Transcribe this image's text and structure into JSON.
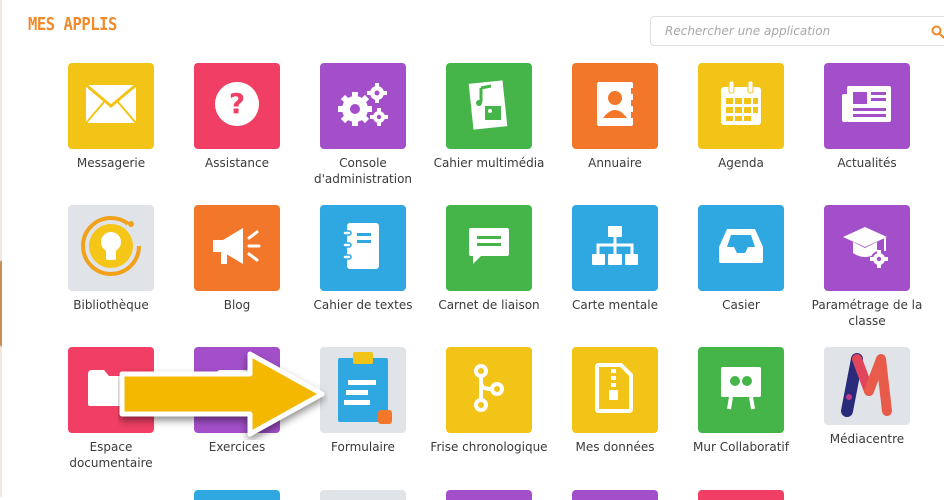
{
  "header": {
    "title": "MES APPLIS",
    "search_placeholder": "Rechercher une application"
  },
  "colors": {
    "accent": "#f08a2b"
  },
  "apps": [
    {
      "label": "Messagerie",
      "icon": "envelope-icon",
      "color": "#f2c418"
    },
    {
      "label": "Assistance",
      "icon": "question-icon",
      "color": "#f03e64"
    },
    {
      "label": "Console d'administration",
      "icon": "gears-icon",
      "color": "#a24fc9"
    },
    {
      "label": "Cahier multimédia",
      "icon": "multimedia-book-icon",
      "color": "#45b54a"
    },
    {
      "label": "Annuaire",
      "icon": "address-book-icon",
      "color": "#f2772a"
    },
    {
      "label": "Agenda",
      "icon": "calendar-icon",
      "color": "#f2c418"
    },
    {
      "label": "Actualités",
      "icon": "newspaper-icon",
      "color": "#a24fc9"
    },
    {
      "label": "Bibliothèque",
      "icon": "lightbulb-icon",
      "color": "#e0e3e8"
    },
    {
      "label": "Blog",
      "icon": "megaphone-icon",
      "color": "#f2772a"
    },
    {
      "label": "Cahier de textes",
      "icon": "notebook-icon",
      "color": "#2fa7e0"
    },
    {
      "label": "Carnet de liaison",
      "icon": "chat-bubble-icon",
      "color": "#45b54a"
    },
    {
      "label": "Carte mentale",
      "icon": "sitemap-icon",
      "color": "#2fa7e0"
    },
    {
      "label": "Casier",
      "icon": "inbox-tray-icon",
      "color": "#2fa7e0"
    },
    {
      "label": "Paramétrage de la classe",
      "icon": "graduation-cap-gear-icon",
      "color": "#a24fc9"
    },
    {
      "label": "Espace documentaire",
      "icon": "folder-icon",
      "color": "#f03e64"
    },
    {
      "label": "Exercices",
      "icon": "exercises-icon",
      "color": "#a24fc9"
    },
    {
      "label": "Formulaire",
      "icon": "clipboard-form-icon",
      "color": "#e0e3e8"
    },
    {
      "label": "Frise chronologique",
      "icon": "timeline-icon",
      "color": "#f2c418"
    },
    {
      "label": "Mes données",
      "icon": "zip-file-icon",
      "color": "#f2c418"
    },
    {
      "label": "Mur Collaboratif",
      "icon": "collaborative-wall-icon",
      "color": "#45b54a"
    },
    {
      "label": "Médiacentre",
      "icon": "mediacentre-logo-icon",
      "color": "#e0e3e8"
    }
  ]
}
